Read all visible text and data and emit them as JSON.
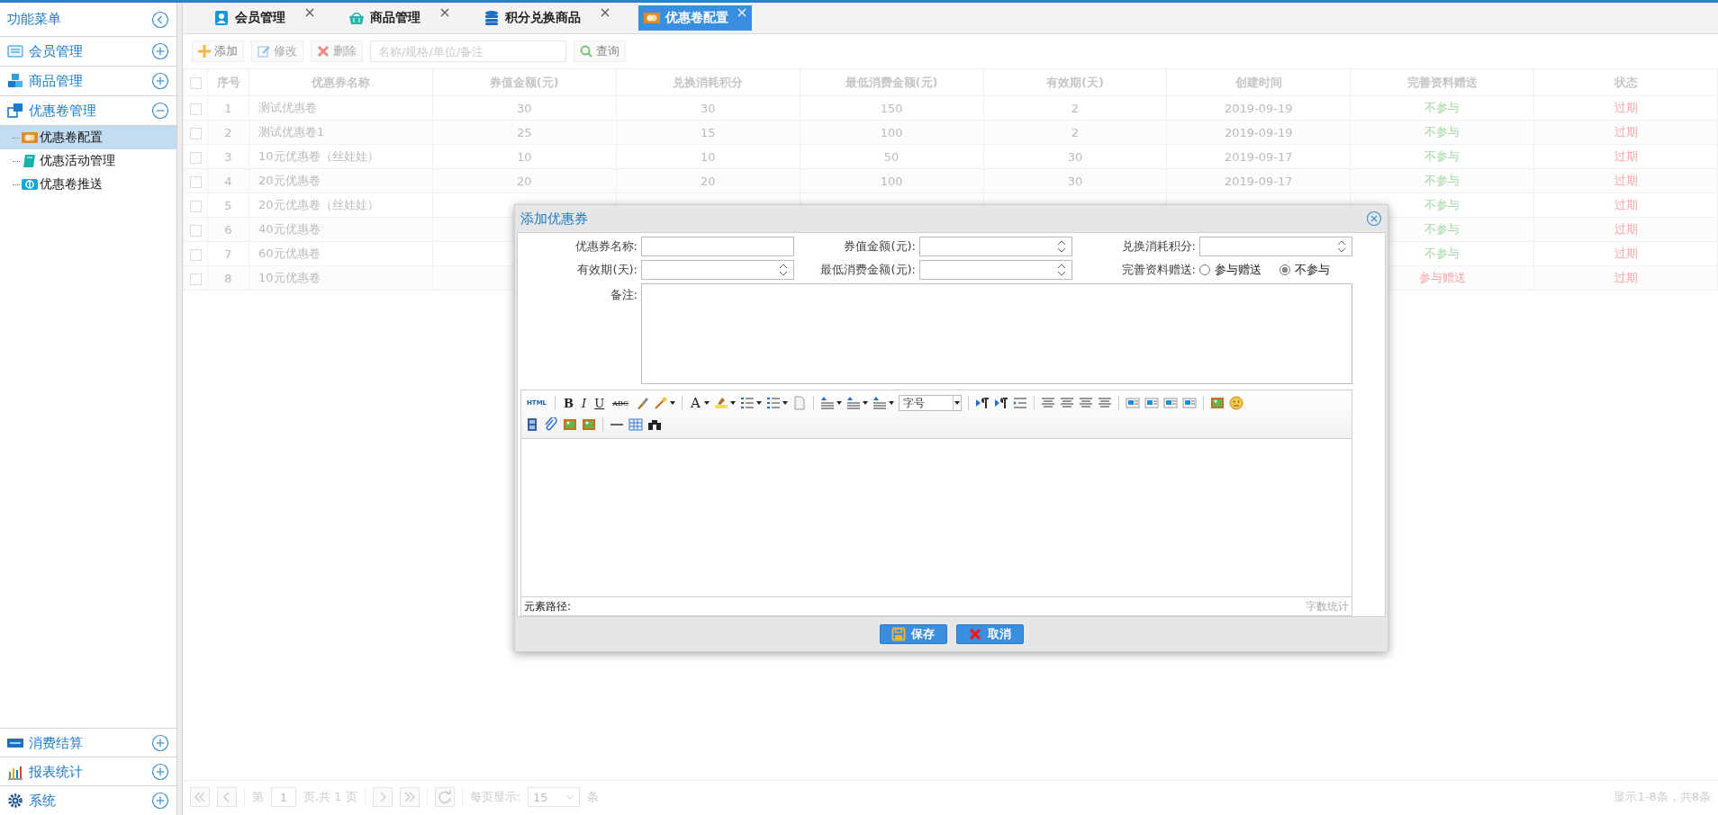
{
  "sidebar": {
    "title": "功能菜单",
    "groups": [
      {
        "label": "会员管理",
        "expanded": false
      },
      {
        "label": "商品管理",
        "expanded": false
      },
      {
        "label": "优惠卷管理",
        "expanded": true,
        "children": [
          {
            "label": "优惠卷配置",
            "selected": true
          },
          {
            "label": "优惠活动管理",
            "selected": false
          },
          {
            "label": "优惠卷推送",
            "selected": false
          }
        ]
      }
    ],
    "footer_groups": [
      {
        "label": "消费结算",
        "expanded": false
      },
      {
        "label": "报表统计",
        "expanded": false
      },
      {
        "label": "系统",
        "expanded": false
      }
    ]
  },
  "tabs": [
    {
      "label": "会员管理",
      "selected": false
    },
    {
      "label": "商品管理",
      "selected": false
    },
    {
      "label": "积分兑换商品",
      "selected": false
    },
    {
      "label": "优惠卷配置",
      "selected": true
    }
  ],
  "toolbar": {
    "buttons": [
      {
        "label": "添加",
        "disabled": false
      },
      {
        "label": "修改",
        "disabled": true
      },
      {
        "label": "删除",
        "disabled": true
      }
    ],
    "search": {
      "placeholder": "名称/规格/单位/备注"
    },
    "query": "查询"
  },
  "table": {
    "all_checked": false,
    "columns": [
      "序号",
      "优惠券名称",
      "券值金额(元)",
      "兑换消耗积分",
      "最低消费金额(元)",
      "有效期(天)",
      "创建时间",
      "完善资料赠送",
      "状态"
    ],
    "rows": [
      {
        "checked": false,
        "cells": [
          "1",
          "测试优惠卷",
          "30",
          "30",
          "150",
          "2",
          "2019-09-19"
        ],
        "gift": {
          "text": "不参与",
          "color": "#a3d9a5"
        },
        "status": {
          "text": "过期",
          "color": "#f7a8a8"
        }
      },
      {
        "checked": false,
        "cells": [
          "2",
          "测试优惠卷1",
          "25",
          "15",
          "100",
          "2",
          "2019-09-19"
        ],
        "gift": {
          "text": "不参与",
          "color": "#a3d9a5"
        },
        "status": {
          "text": "过期",
          "color": "#f7a8a8"
        }
      },
      {
        "checked": false,
        "cells": [
          "3",
          "10元优惠卷（丝娃娃）",
          "10",
          "10",
          "50",
          "30",
          "2019-09-17"
        ],
        "gift": {
          "text": "不参与",
          "color": "#a3d9a5"
        },
        "status": {
          "text": "过期",
          "color": "#f7a8a8"
        }
      },
      {
        "checked": false,
        "cells": [
          "4",
          "20元优惠卷",
          "20",
          "20",
          "100",
          "30",
          "2019-09-17"
        ],
        "gift": {
          "text": "不参与",
          "color": "#a3d9a5"
        },
        "status": {
          "text": "过期",
          "color": "#f7a8a8"
        }
      },
      {
        "checked": false,
        "cells": [
          "5",
          "20元优惠卷（丝娃娃）"
        ],
        "gift": {
          "text": "不参与",
          "color": "#a3d9a5"
        },
        "status": {
          "text": "过期",
          "color": "#f7a8a8"
        }
      },
      {
        "checked": false,
        "cells": [
          "6",
          "40元优惠卷"
        ],
        "gift": {
          "text": "不参与",
          "color": "#a3d9a5"
        },
        "status": {
          "text": "过期",
          "color": "#f7a8a8"
        }
      },
      {
        "checked": false,
        "cells": [
          "7",
          "60元优惠卷"
        ],
        "gift": {
          "text": "不参与",
          "color": "#a3d9a5"
        },
        "status": {
          "text": "过期",
          "color": "#f7a8a8"
        }
      },
      {
        "checked": false,
        "cells": [
          "8",
          "10元优惠卷"
        ],
        "gift": {
          "text": "参与赠送",
          "color": "#f7a8a8"
        },
        "status": {
          "text": "过期",
          "color": "#f7a8a8"
        }
      }
    ]
  },
  "pager": {
    "page_label": "第",
    "page": "1",
    "page_total": "页,共 1 页",
    "per_page_label": "每页显示:",
    "per_page": "15",
    "per_page_unit": "条",
    "summary": "显示1-8条，共8条"
  },
  "dialog": {
    "title": "添加优惠券",
    "fields": [
      {
        "kind": "text",
        "label": "优惠券名称:"
      },
      {
        "kind": "number",
        "label": "券值金额(元):"
      },
      {
        "kind": "number",
        "label": "兑换消耗积分:"
      },
      {
        "kind": "number",
        "label": "有效期(天):"
      },
      {
        "kind": "number",
        "label": "最低消费金额(元):"
      },
      {
        "kind": "radio",
        "label": "完善资料赠送:",
        "options": [
          {
            "label": "参与赠送",
            "selected": false
          },
          {
            "label": "不参与",
            "selected": true
          }
        ]
      }
    ],
    "remark_label": "备注:",
    "editor": {
      "toolbar_rows": [
        [
          {
            "kind": "text",
            "label": "HTML"
          },
          {
            "kind": "separator"
          },
          {
            "kind": "text",
            "label": "B"
          },
          {
            "kind": "text",
            "label": "I"
          },
          {
            "kind": "text",
            "label": "U"
          },
          {
            "kind": "text",
            "label": "ABC"
          },
          {
            "kind": "icon"
          },
          {
            "kind": "icon",
            "dropdown": true
          },
          {
            "kind": "separator"
          },
          {
            "kind": "text",
            "label": "A",
            "dropdown": true
          },
          {
            "kind": "icon",
            "dropdown": true
          },
          {
            "kind": "icon",
            "dropdown": true
          },
          {
            "kind": "icon",
            "dropdown": true
          },
          {
            "kind": "icon"
          },
          {
            "kind": "separator"
          },
          {
            "kind": "icon",
            "dropdown": true
          },
          {
            "kind": "icon",
            "dropdown": true
          },
          {
            "kind": "icon",
            "dropdown": true
          },
          {
            "kind": "select",
            "label": "字号"
          },
          {
            "kind": "separator"
          },
          {
            "kind": "icon"
          },
          {
            "kind": "icon"
          },
          {
            "kind": "icon"
          },
          {
            "kind": "separator"
          },
          {
            "kind": "icon"
          },
          {
            "kind": "icon"
          },
          {
            "kind": "icon"
          },
          {
            "kind": "icon"
          },
          {
            "kind": "separator"
          },
          {
            "kind": "icon"
          },
          {
            "kind": "icon"
          },
          {
            "kind": "icon"
          },
          {
            "kind": "icon"
          },
          {
            "kind": "separator"
          },
          {
            "kind": "icon"
          },
          {
            "kind": "icon"
          }
        ],
        [
          {
            "kind": "icon"
          },
          {
            "kind": "icon"
          },
          {
            "kind": "icon"
          },
          {
            "kind": "icon"
          },
          {
            "kind": "separator"
          },
          {
            "kind": "icon"
          },
          {
            "kind": "icon"
          },
          {
            "kind": "icon"
          }
        ]
      ],
      "path_label": "元素路径:",
      "word_count": "字数统计"
    },
    "buttons": [
      {
        "kind": "save",
        "label": "保存"
      },
      {
        "kind": "cancel",
        "label": "取消"
      }
    ]
  }
}
